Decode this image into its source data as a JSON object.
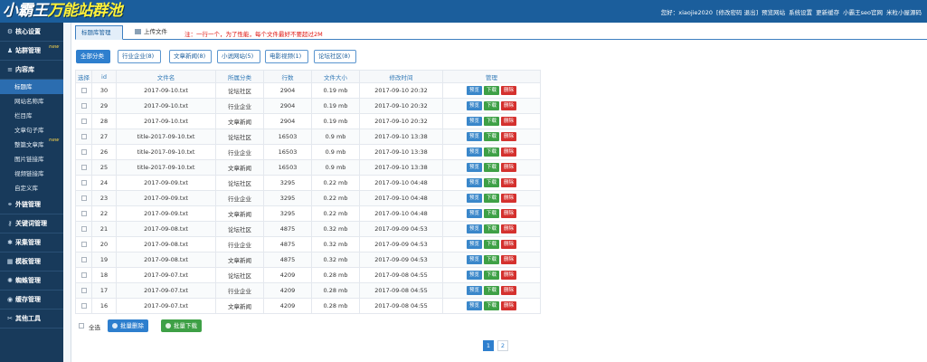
{
  "logo": {
    "part1": "小霸王",
    "part2": "万能站群池"
  },
  "topnav": [
    "您好：xiaojie2020",
    "[修改密码 退出]",
    "预览网站",
    "系统设置",
    "更新缓存",
    "小霸王seo官网",
    "米粒小屋源码"
  ],
  "sidebar": {
    "items": [
      {
        "label": "核心设置",
        "icon": "gear-icon",
        "glyph": "⚙"
      },
      {
        "label": "站群管理",
        "icon": "user-icon",
        "glyph": "♟",
        "badge": "new"
      },
      {
        "label": "内容库",
        "icon": "list-icon",
        "glyph": "≡"
      }
    ],
    "subitems": [
      {
        "label": "标题库",
        "active": true
      },
      {
        "label": "网站名称库"
      },
      {
        "label": "栏目库"
      },
      {
        "label": "文章句子库"
      },
      {
        "label": "整篇文章库",
        "badge": "new"
      },
      {
        "label": "图片链接库"
      },
      {
        "label": "视频链接库"
      },
      {
        "label": "自定义库"
      }
    ],
    "bottom": [
      {
        "label": "外链管理",
        "icon": "link-icon",
        "glyph": "⚭"
      },
      {
        "label": "关键词管理",
        "icon": "key-icon",
        "glyph": "⚷"
      },
      {
        "label": "采集管理",
        "icon": "collect-icon",
        "glyph": "✱"
      },
      {
        "label": "模板管理",
        "icon": "template-icon",
        "glyph": "▦"
      },
      {
        "label": "蜘蛛管理",
        "icon": "spider-icon",
        "glyph": "✺"
      },
      {
        "label": "缓存管理",
        "icon": "cache-icon",
        "glyph": "◉"
      },
      {
        "label": "其他工具",
        "icon": "tools-icon",
        "glyph": "✂"
      }
    ]
  },
  "tabs": [
    {
      "label": "标题库管理",
      "active": true
    },
    {
      "label": "上传文件",
      "active": false
    }
  ],
  "notice": "注：一行一个，为了性能，每个文件最好不要超过2M",
  "categories": [
    {
      "label": "全部分类",
      "active": true
    },
    {
      "label": "行业企业(8)"
    },
    {
      "label": "文章新闻(8)"
    },
    {
      "label": "小说网站(5)"
    },
    {
      "label": "电影视频(1)"
    },
    {
      "label": "论坛社区(8)"
    }
  ],
  "table": {
    "headers": [
      "选择",
      "id",
      "文件名",
      "所属分类",
      "行数",
      "文件大小",
      "修改时间",
      "管理"
    ],
    "actions": {
      "preview": "预览",
      "download": "下载",
      "delete": "删除"
    },
    "rows": [
      {
        "id": "30",
        "name": "2017-09-10.txt",
        "cat": "论坛社区",
        "lines": "2904",
        "size": "0.19 mb",
        "time": "2017-09-10 20:32"
      },
      {
        "id": "29",
        "name": "2017-09-10.txt",
        "cat": "行业企业",
        "lines": "2904",
        "size": "0.19 mb",
        "time": "2017-09-10 20:32"
      },
      {
        "id": "28",
        "name": "2017-09-10.txt",
        "cat": "文章新闻",
        "lines": "2904",
        "size": "0.19 mb",
        "time": "2017-09-10 20:32"
      },
      {
        "id": "27",
        "name": "title-2017-09-10.txt",
        "cat": "论坛社区",
        "lines": "16503",
        "size": "0.9 mb",
        "time": "2017-09-10 13:38"
      },
      {
        "id": "26",
        "name": "title-2017-09-10.txt",
        "cat": "行业企业",
        "lines": "16503",
        "size": "0.9 mb",
        "time": "2017-09-10 13:38"
      },
      {
        "id": "25",
        "name": "title-2017-09-10.txt",
        "cat": "文章新闻",
        "lines": "16503",
        "size": "0.9 mb",
        "time": "2017-09-10 13:38"
      },
      {
        "id": "24",
        "name": "2017-09-09.txt",
        "cat": "论坛社区",
        "lines": "3295",
        "size": "0.22 mb",
        "time": "2017-09-10 04:48"
      },
      {
        "id": "23",
        "name": "2017-09-09.txt",
        "cat": "行业企业",
        "lines": "3295",
        "size": "0.22 mb",
        "time": "2017-09-10 04:48"
      },
      {
        "id": "22",
        "name": "2017-09-09.txt",
        "cat": "文章新闻",
        "lines": "3295",
        "size": "0.22 mb",
        "time": "2017-09-10 04:48"
      },
      {
        "id": "21",
        "name": "2017-09-08.txt",
        "cat": "论坛社区",
        "lines": "4875",
        "size": "0.32 mb",
        "time": "2017-09-09 04:53"
      },
      {
        "id": "20",
        "name": "2017-09-08.txt",
        "cat": "行业企业",
        "lines": "4875",
        "size": "0.32 mb",
        "time": "2017-09-09 04:53"
      },
      {
        "id": "19",
        "name": "2017-09-08.txt",
        "cat": "文章新闻",
        "lines": "4875",
        "size": "0.32 mb",
        "time": "2017-09-09 04:53"
      },
      {
        "id": "18",
        "name": "2017-09-07.txt",
        "cat": "论坛社区",
        "lines": "4209",
        "size": "0.28 mb",
        "time": "2017-09-08 04:55"
      },
      {
        "id": "17",
        "name": "2017-09-07.txt",
        "cat": "行业企业",
        "lines": "4209",
        "size": "0.28 mb",
        "time": "2017-09-08 04:55"
      },
      {
        "id": "16",
        "name": "2017-09-07.txt",
        "cat": "文章新闻",
        "lines": "4209",
        "size": "0.28 mb",
        "time": "2017-09-08 04:55"
      }
    ]
  },
  "footer": {
    "select_all": "全选",
    "batch_delete": "批量删除",
    "batch_download": "批量下载"
  },
  "pager": {
    "pages": [
      "1",
      "2"
    ],
    "current": "1"
  }
}
